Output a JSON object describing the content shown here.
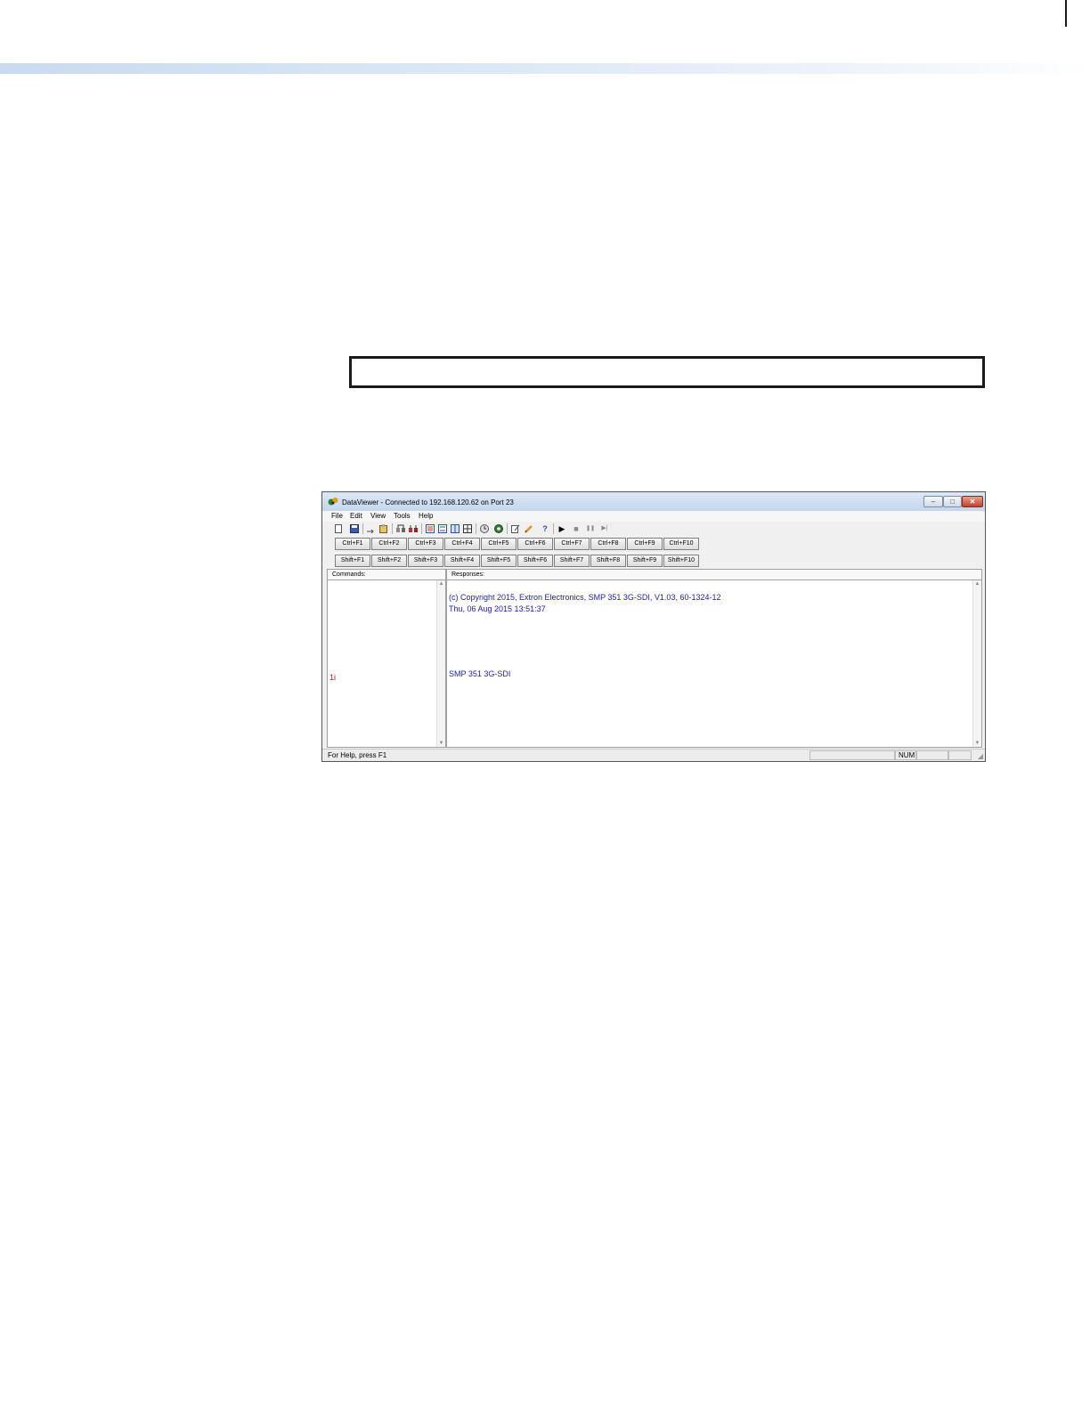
{
  "window": {
    "title": "DataViewer - Connected to 192.168.120.62 on Port 23",
    "controls": {
      "minimize": "–",
      "maximize": "□",
      "close": "✕"
    }
  },
  "menu": [
    "File",
    "Edit",
    "View",
    "Tools",
    "Help"
  ],
  "toolbar": {
    "icons": [
      "new-file-icon",
      "save-icon",
      "open-icon",
      "paste-icon",
      "connect-icon",
      "disconnect-icon",
      "hex-view-icon",
      "ascii-view-icon",
      "split-view-icon",
      "grid-view-icon",
      "clock-icon",
      "settings-icon",
      "edit-icon",
      "pencil-icon",
      "help-icon",
      "play-icon",
      "stop-icon",
      "pause-icon",
      "step-icon"
    ],
    "glyphs": {
      "play": "▶",
      "stop": "■",
      "pause": "❚❚",
      "step": "▶|",
      "help": "?"
    }
  },
  "ctrl_keys": [
    "Ctrl+F1",
    "Ctrl+F2",
    "Ctrl+F3",
    "Ctrl+F4",
    "Ctrl+F5",
    "Ctrl+F6",
    "Ctrl+F7",
    "Ctrl+F8",
    "Ctrl+F9",
    "Ctrl+F10"
  ],
  "shift_keys": [
    "Shift+F1",
    "Shift+F2",
    "Shift+F3",
    "Shift+F4",
    "Shift+F5",
    "Shift+F6",
    "Shift+F7",
    "Shift+F8",
    "Shift+F9",
    "Shift+F10"
  ],
  "panes": {
    "commands_label": "Commands:",
    "responses_label": "Responses:",
    "commands": [
      "1i"
    ],
    "responses": [
      "(c) Copyright 2015, Extron Electronics, SMP 351 3G-SDI, V1.03, 60-1324-12",
      "Thu, 06 Aug 2015 13:51:37",
      "SMP 351 3G-SDI"
    ],
    "scroll_up": "▲",
    "scroll_down": "▼"
  },
  "status": {
    "help_text": "For Help, press F1",
    "num": "NUM",
    "grip": "◢"
  }
}
